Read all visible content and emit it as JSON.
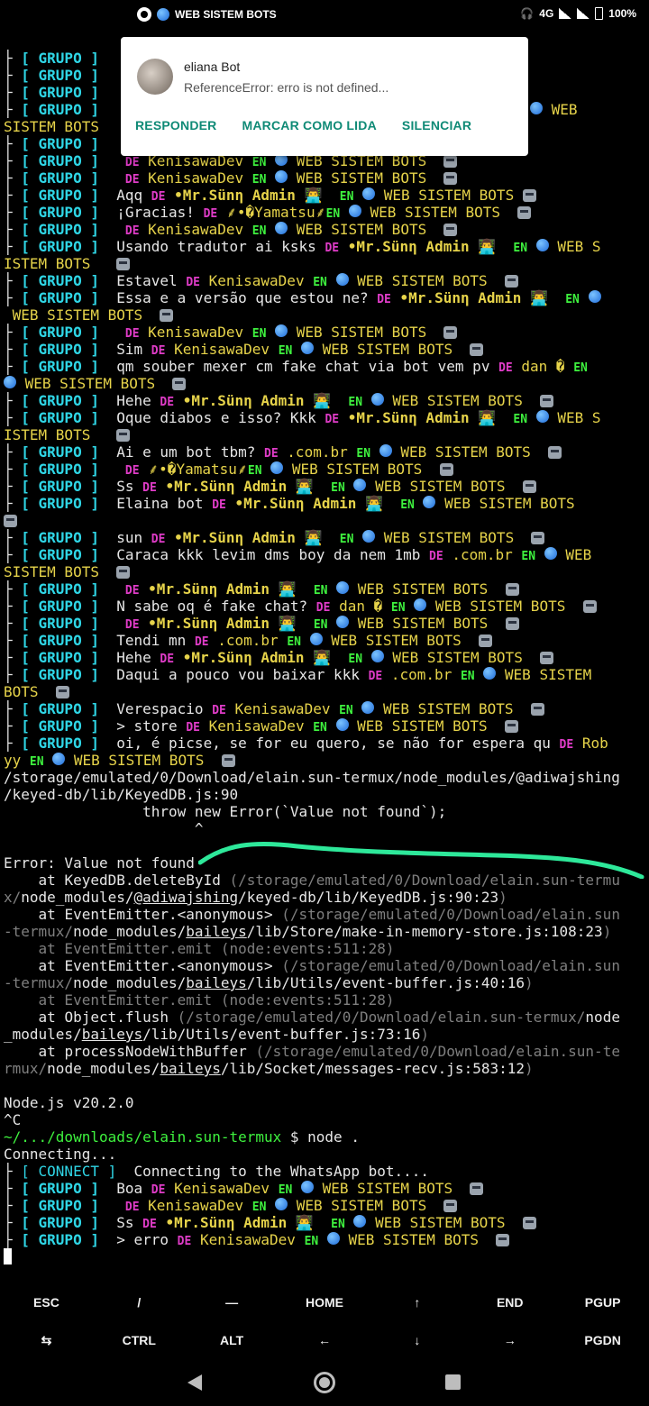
{
  "status_bar": {
    "title": "WEB SISTEM BOTS",
    "network": "4G",
    "battery": "100%"
  },
  "notification": {
    "title": "eliana Bot",
    "text": "ReferenceError: erro is not defined...",
    "actions": [
      "RESPONDER",
      "MARCAR COMO LIDA",
      "SILENCIAR"
    ]
  },
  "terminal": {
    "group_tag": "GRUPO",
    "connect_tag": "CONNECT",
    "de": "DE",
    "en": "EN",
    "bots": "WEB SISTEM BOTS",
    "users": {
      "keni": "KenisawaDev",
      "sun": "•Mr.Sünη Admin 👨‍💻",
      "yama": "⸙•�Yamatsu⸙",
      "combr": ".com.br",
      "dan": "dan �",
      "rob": "Rob"
    },
    "messages": {
      "m01": "Aqq",
      "m02": "¡Gracias!",
      "m03": "Usando tradutor ai ksks",
      "m04": "Estavel",
      "m05": "Essa e a versão que estou ne?",
      "m06": "Sim",
      "m07": "qm souber mexer cm fake chat via bot vem pv",
      "m08": "Hehe",
      "m09": "Oque diabos e isso? Kkk",
      "m10": "Ai e um bot tbm?",
      "m11": "Ss",
      "m12": "Elaina bot",
      "m13": "sun",
      "m14": "Caraca kkk levim dms boy da nem 1mb",
      "m15": "N sabe oq é fake chat?",
      "m16": "Tendi mn",
      "m17": "Daqui a pouco vou baixar kkk",
      "m18": "Verespacio",
      "m19": "> store",
      "m20": "oi, é picse, se for eu quero, se não for espera qu",
      "m21": "> erro"
    },
    "wrap": {
      "w1": "SISTEM BOTS",
      "w2": "WEB S",
      "w3": "ISTEM BOTS",
      "w4": "WEB",
      "w5": "BOTS",
      "w6": "WEB SISTEM",
      "w7": "yy"
    },
    "error_block": {
      "path1": "/storage/emulated/0/Download/elain.sun-termux/node_modules/@adiwajshing",
      "path2": "/keyed-db/lib/KeyedDB.js:90",
      "throw_line": "throw new Error(`Value not found`);",
      "caret": "^",
      "error_msg": "Error: Value not found",
      "at": "at",
      "s1_fn": "KeyedDB.deleteById",
      "s1_a": "(/storage/emulated/0/Download/elain.sun-termu",
      "s1_b": "x/",
      "s1_c": "node_modules/",
      "s1_d": "@adiwajshing",
      "s1_e": "/keyed-db/lib/KeyedDB.js:90:23",
      "s1_f": ")",
      "s2_fn": "EventEmitter.<anonymous>",
      "s2_a": "(/storage/emulated/0/Download/elain.sun",
      "s2_b": "-termux/",
      "s2_c": "node_modules/",
      "s2_d": "baileys",
      "s2_e": "/lib/Store/make-in-memory-store.js:108:23",
      "s2_f": ")",
      "s3": "at EventEmitter.emit (node:events:511:28)",
      "s4_fn": "EventEmitter.<anonymous>",
      "s4_a": "(/storage/emulated/0/Download/elain.sun",
      "s4_b": "-termux/",
      "s4_c": "node_modules/",
      "s4_d": "baileys",
      "s4_e": "/lib/Utils/event-buffer.js:40:16",
      "s4_f": ")",
      "s5": "at EventEmitter.emit (node:events:511:28)",
      "s6_fn": "Object.flush",
      "s6_a": "(/storage/emulated/0/Download/elain.sun-termux/",
      "s6_b": "node",
      "s6_c": "_modules/",
      "s6_d": "baileys",
      "s6_e": "/lib/Utils/event-buffer.js:73:16",
      "s6_f": ")",
      "s7_fn": "processNodeWithBuffer",
      "s7_a": "(/storage/emulated/0/Download/elain.sun-te",
      "s7_b": "rmux/",
      "s7_c": "node_modules/",
      "s7_d": "baileys",
      "s7_e": "/lib/Socket/messages-recv.js:583:12",
      "s7_f": ")"
    },
    "node_version": "Node.js v20.2.0",
    "ctrl_c": "^C",
    "prompt_path": "~/.../downloads/elain.sun-termux",
    "prompt_cmd": "$ node .",
    "connecting": "Connecting...",
    "connect_msg": "Connecting to the WhatsApp bot...."
  },
  "extra_keys": {
    "row1": [
      "ESC",
      "/",
      "—",
      "HOME",
      "↑",
      "END",
      "PGUP"
    ],
    "row2": [
      "⇆",
      "CTRL",
      "ALT",
      "←",
      "↓",
      "→",
      "PGDN"
    ]
  },
  "colors": {
    "group": "#2fd6e6",
    "de": "#e03cc8",
    "en": "#3ef13e",
    "name": "#e6d34a",
    "notification_action": "#0f8a76"
  }
}
